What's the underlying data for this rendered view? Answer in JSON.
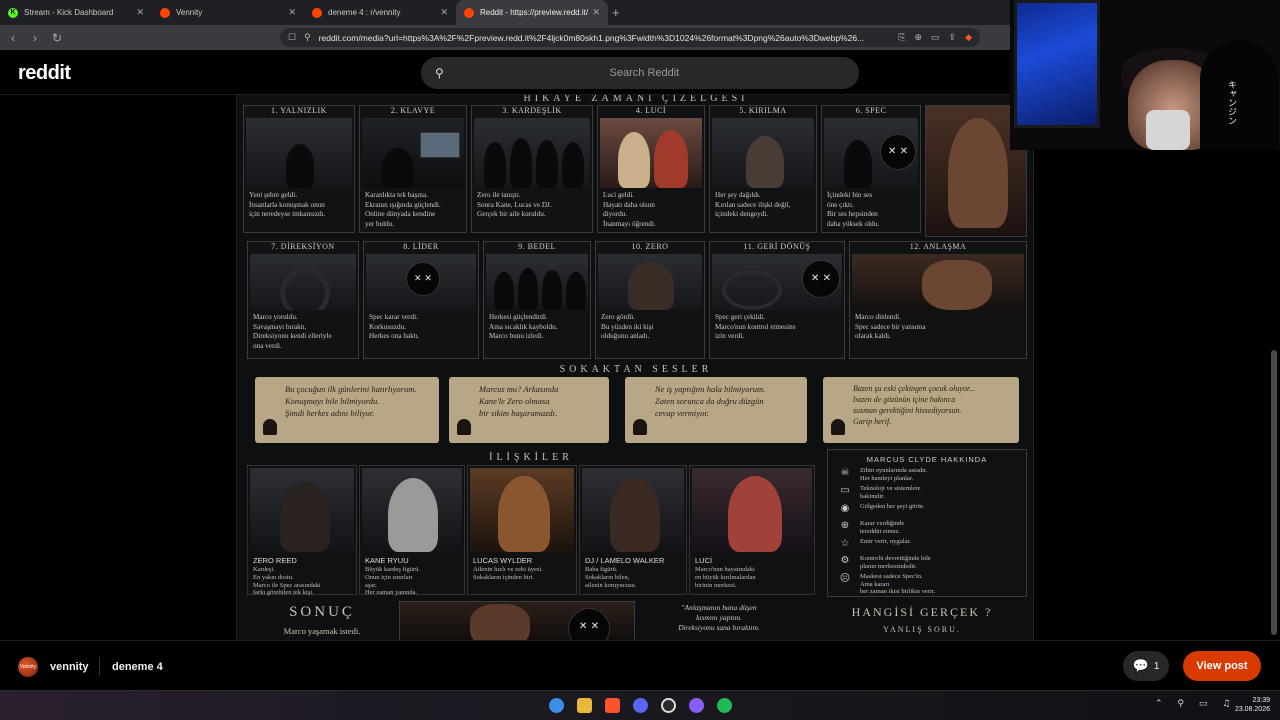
{
  "browser": {
    "tabs": [
      {
        "title": "Stream - Kick Dashboard",
        "color": "#53fc18",
        "glyph": "K"
      },
      {
        "title": "Vennity",
        "color": "#ff4500",
        "glyph": ""
      },
      {
        "title": "deneme 4 : r/vennity",
        "color": "#ff4500",
        "glyph": ""
      },
      {
        "title": "Reddit - https://preview.redd.it/",
        "color": "#ff4500",
        "glyph": ""
      }
    ],
    "active_tab": 3,
    "url": "reddit.com/media?url=https%3A%2F%2Fpreview.redd.it%2F4ljck0m80skh1.png%3Fwidth%3D1024%26format%3Dpng%26auto%3Dwebp%26..."
  },
  "site": {
    "logo": "reddit",
    "search_placeholder": "Search Reddit"
  },
  "poster": {
    "timeline_title": "HİKAYE ZAMANI ÇİZELGESİ",
    "panels_row1": [
      {
        "title": "1. YALNIZLIK",
        "text": "Yeni şehre geldi.\nİnsanlarla konuşmak onun\niçin neredeyse imkansızdı."
      },
      {
        "title": "2. KLAVYE",
        "text": "Karanlıkta tek başına.\nEkranın ışığında güçlendi.\nOnline dünyada kendine\nyer buldu."
      },
      {
        "title": "3. KARDEŞLİK",
        "text": "Zero ile tanıştı.\nSonra Kane, Lucas ve DJ.\nGerçek bir aile kuruldu."
      },
      {
        "title": "4. LUCİ",
        "text": "Luci geldi.\nHayatı daha olsun\ndiyordu.\nİnanmayı öğrendi."
      },
      {
        "title": "5. KIRILMA",
        "text": "Her şey dağıldı.\nKırılan sadece ilişki değil,\niçindeki dengeydi."
      },
      {
        "title": "6. SPEC",
        "text": "İçindeki bin ses\nöne çıktı.\nBir ses hepsinden\ndaha yüksek oldu."
      }
    ],
    "panels_row2": [
      {
        "title": "7. DİREKSİYON",
        "text": "Marco yoruldu.\nSavaşmayı bıraktı.\nDireksiyonu kendi elleriyle\nona verdi."
      },
      {
        "title": "8. LİDER",
        "text": "Spec karar verdi.\nKorkusuzdu.\nHerkes ona baktı."
      },
      {
        "title": "9. BEDEL",
        "text": "Herkesi güçlendirdi.\nAma sıcaklık kayboldu.\nMarco bunu izledi."
      },
      {
        "title": "10. ZERO",
        "text": "Zero gördü.\nBu yüzden iki kişi\nolduğunu anladı."
      },
      {
        "title": "11. GERİ DÖNÜŞ",
        "text": "Spec geri çekildi.\nMarco'nun kontrol etmesine\nizin verdi."
      },
      {
        "title": "12. ANLAŞMA",
        "text": "Marco dinlendi.\nSpec sadece bir yansıma\nolarak kaldı."
      }
    ],
    "street_title": "SOKAKTAN SESLER",
    "quotes": [
      "Bu çocuğun ilk günlerini hatırlıyorum.\nKonuşmayı bile bilmiyordu.\nŞimdi herkes adını biliyor.",
      "Marcus mu? Arkasında\nKane'le Zero olmasa\nbir sikim başaramazdı.",
      "Ne iş yaptığını hala bilmiyorum.\nZaten sorunca da doğru düzgün\ncevap vermiyor.",
      "Bazen şu eski çekingen çocuk oluyor...\nbazen de gözünün içine bakınca\nsusman gerektiğini hissediyorsun.\nGarip herif."
    ],
    "relations_title": "İLİŞKİLER",
    "characters": [
      {
        "name": "ZERO REED",
        "text": "Kardeşi.\nEn yakın dostu.\nMarco ile Spec arasındaki\nfarkı görebilen tek kişi."
      },
      {
        "name": "KANE RYUU",
        "text": "Büyük kardeş figürü.\nOnun için sınırları\naşar.\nHer zaman yanında."
      },
      {
        "name": "LUCAS WYLDER",
        "text": "Ailenin hızlı ve zeki üyesi.\nSokakların içinden biri."
      },
      {
        "name": "DJ / LAMELO WALKER",
        "text": "Baba figürü.\nSokakların bilen,\nailenin koruyucusu."
      },
      {
        "name": "LUCİ",
        "text": "Marco'nun hayatındaki\nen büyük kırılmalardan\nbirinin merkezi."
      }
    ],
    "about": {
      "title": "MARCUS CLYDE HAKKINDA",
      "items": [
        {
          "icon": "skull-icon",
          "glyph": "☠",
          "text": "Zihin oyunlarında ustadır.\nHer hamleyi planlar."
        },
        {
          "icon": "laptop-icon",
          "glyph": "▭",
          "text": "Teknoloji ve sistemlere\nhakimdir."
        },
        {
          "icon": "eye-icon",
          "glyph": "◉",
          "text": "Gölgeden her şeyi görür."
        },
        {
          "icon": "target-icon",
          "glyph": "⊕",
          "text": "Karar verdiğinde\ntereddüt etmez."
        },
        {
          "icon": "star-icon",
          "glyph": "☆",
          "text": "Emir verir, uygular."
        },
        {
          "icon": "gear-icon",
          "glyph": "⚙",
          "text": "Kontrolü devrettiğinde bile\nplanın merkezindedir."
        },
        {
          "icon": "mask-icon",
          "glyph": "☹",
          "text": "Maskesi sadece Spec'in.\nAma kararı\nher zaman ikisi birlikte verir."
        }
      ]
    },
    "conclusion_title": "SONUÇ",
    "conclusion_text": "Marco yaşamak istedi.",
    "final_quote": "\"Anlaşmanın bana düşen\nkısmını yaptım.\nDireksiyonu sana bıraktım.",
    "which_title": "HANGİSİ GERÇEK ?",
    "which_text": "YANLIŞ SORU."
  },
  "post": {
    "subreddit": "vennity",
    "avatar_text": "Vennity",
    "title": "deneme 4",
    "comments": "1",
    "view_label": "View post"
  },
  "taskbar": {
    "time": "23:39",
    "date": "23.08.2026"
  },
  "webcam": {
    "chair_text": "キャンジン"
  }
}
